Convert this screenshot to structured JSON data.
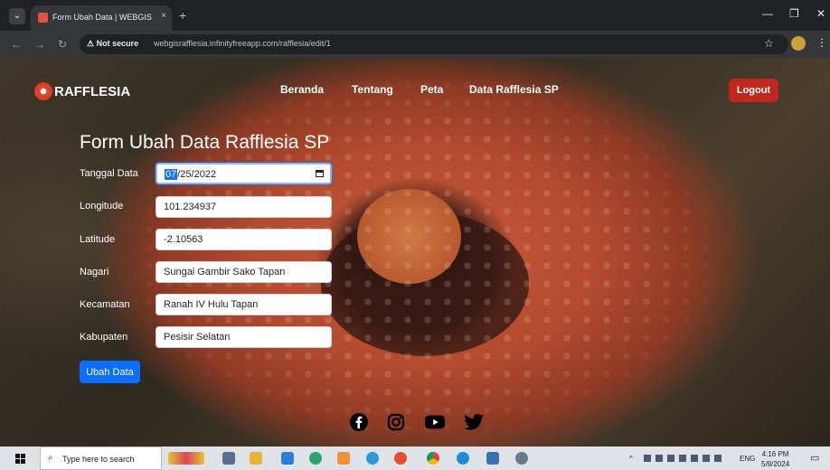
{
  "browser": {
    "tab_title": "Form Ubah Data | WEBGIS Raffl",
    "tab_close": "×",
    "new_tab": "+",
    "security_label": "⚠ Not secure",
    "url": "webgisrafflesia.infinityfreeapp.com/rafflesia/edit/1"
  },
  "site": {
    "brand": "RAFFLESIA",
    "nav": [
      "Beranda",
      "Tentang",
      "Peta",
      "Data Rafflesia SP"
    ],
    "logout": "Logout"
  },
  "form": {
    "title": "Form Ubah Data Rafflesia SP",
    "fields": [
      {
        "label": "Tanggal Data",
        "value_highlight": "07",
        "value_rest": "/25/2022"
      },
      {
        "label": "Longitude",
        "value": "101.234937"
      },
      {
        "label": "Latitude",
        "value": "-2.10563"
      },
      {
        "label": "Nagari",
        "value": "Sungai Gambir Sako Tapan"
      },
      {
        "label": "Kecamatan",
        "value": "Ranah IV Hulu Tapan"
      },
      {
        "label": "Kabupaten",
        "value": "Pesisir Selatan"
      }
    ],
    "submit": "Ubah Data"
  },
  "social": [
    "facebook-icon",
    "instagram-icon",
    "youtube-icon",
    "twitter-icon"
  ],
  "taskbar": {
    "search_placeholder": "Type here to search",
    "lang": "ENG",
    "time": "4:16 PM",
    "date": "5/9/2024"
  },
  "colors": {
    "logout": "#c0281f",
    "primary": "#0d6efd",
    "chrome_bg": "#202124"
  }
}
